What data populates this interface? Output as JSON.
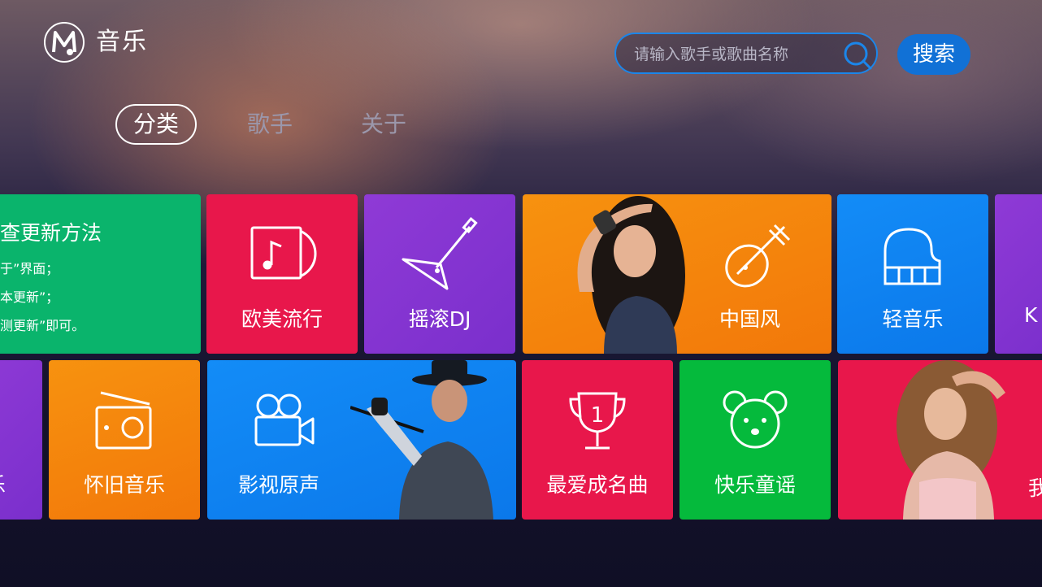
{
  "header": {
    "app_title": "音乐",
    "logo_icon": "music-m-logo-icon"
  },
  "search": {
    "placeholder": "请输入歌手或歌曲名称",
    "button_label": "搜索",
    "accent": "#1b86ea"
  },
  "tabs": [
    {
      "label": "分类",
      "active": true
    },
    {
      "label": "歌手",
      "active": false
    },
    {
      "label": "关于",
      "active": false
    }
  ],
  "notice": {
    "title": "查更新方法",
    "lines": [
      "于”界面；",
      "本更新”；",
      "测更新”即可。"
    ]
  },
  "row1": [
    {
      "label": "欧美流行",
      "icon": "vinyl-record-icon",
      "color": "#e8174b"
    },
    {
      "label": "摇滚DJ",
      "icon": "electric-guitar-icon",
      "color": "#8f3ad6"
    },
    {
      "label": "中国风",
      "icon": "pipa-icon",
      "color": "#f7920f"
    },
    {
      "label": "轻音乐",
      "icon": "piano-icon",
      "color": "#138cf7"
    },
    {
      "label": "K",
      "color": "#7a2fcc"
    }
  ],
  "row2": [
    {
      "label": "乐",
      "color": "#7a2fcc"
    },
    {
      "label": "怀旧音乐",
      "icon": "radio-icon",
      "color": "#f7920f"
    },
    {
      "label": "影视原声",
      "icon": "movie-camera-icon",
      "color": "#138cf7"
    },
    {
      "label": "最爱成名曲",
      "icon": "trophy-icon",
      "trophy_number": "1",
      "color": "#e8174b"
    },
    {
      "label": "快乐童谣",
      "icon": "bear-face-icon",
      "color": "#05ba3c"
    },
    {
      "label": "我",
      "color": "#e8174b"
    }
  ]
}
